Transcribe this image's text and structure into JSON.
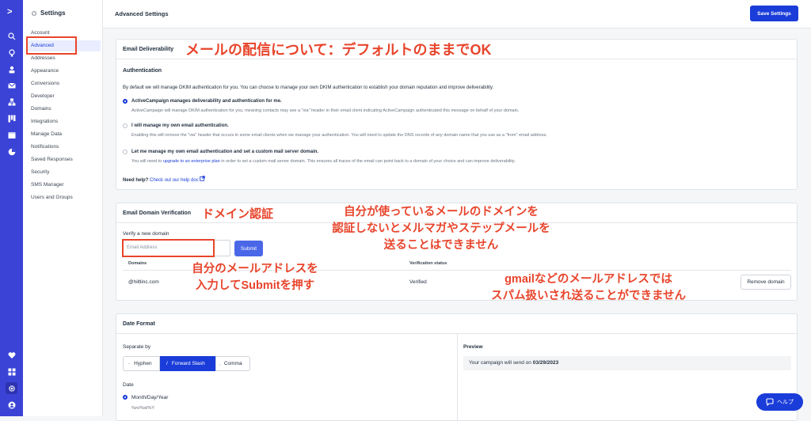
{
  "colors": {
    "brand": "#3b43d6",
    "primary": "#1a3cd9",
    "annotation": "#e8452c"
  },
  "rail": {
    "logo": ">",
    "icons": [
      "search-icon",
      "lightbulb-icon",
      "contacts-icon",
      "email-icon",
      "automations-icon",
      "pipeline-icon",
      "site-icon",
      "reports-icon",
      "heart-icon",
      "apps-icon",
      "gear-icon",
      "avatar-icon"
    ]
  },
  "sidebar": {
    "title": "Settings",
    "items": [
      "Account",
      "Advanced",
      "Addresses",
      "Appearance",
      "Conversions",
      "Developer",
      "Domains",
      "Integrations",
      "Manage Data",
      "Notifications",
      "Saved Responses",
      "Security",
      "SMS Manager",
      "Users and Groups"
    ]
  },
  "header": {
    "title": "Advanced Settings",
    "save_label": "Save Settings"
  },
  "deliverability": {
    "title": "Email Deliverability",
    "section": "Authentication",
    "intro": "By default we will manage DKIM authentication for you. You can choose to manage your own DKIM authentication to establish your domain reputation and improve deliverability.",
    "opt1_title": "ActiveCampaign manages deliverability and authentication for me.",
    "opt1_desc": "ActiveCampaign will manage DKIM authentication for you, meaning contacts may see a \"via\" header in their email client indicating ActiveCampaign authenticated this message on behalf of your domain.",
    "opt2_title": "I will manage my own email authentication.",
    "opt2_desc": "Enabling this will remove the \"via\" header that occurs in some email clients when we manage your authentication. You will need to update the DNS records of any domain name that you use as a \"from\" email address.",
    "opt3_title": "Let me manage my own email authentication and set a custom mail server domain.",
    "opt3_pre": "You will need to",
    "opt3_link": "upgrade to an enterprise plan",
    "opt3_post": "in order to set a custom mail server domain. This ensures all traces of the email can point back to a domain of your choice and can improve deliverability.",
    "help_pre": "Need help?",
    "help_link": "Check out our help doc"
  },
  "verification": {
    "title": "Email Domain Verification",
    "label": "Verify a new domain",
    "placeholder": "Email Address",
    "submit": "Submit",
    "col_domains": "Domains",
    "col_status": "Verification status",
    "domain": "@hiltlinc.com",
    "status": "Verified",
    "remove": "Remove domain"
  },
  "date_format": {
    "title": "Date Format",
    "separate_by": "Separate by",
    "hyphen_sym": "-",
    "hyphen": "Hyphen",
    "slash_sym": "/",
    "slash": "Forward Slash",
    "comma_sym": ",",
    "comma": "Comma",
    "date_label": "Date",
    "date_option": "Month/Day/Year",
    "date_pattern": "%m/%d/%Y",
    "preview_label": "Preview",
    "preview_text": "Your campaign will send on",
    "preview_date": "03/29/2023"
  },
  "annotations": {
    "a1": "メールの配信について：デフォルトのままでOK",
    "a2": "ドメイン認証",
    "a3_l1": "自分が使っているメールのドメインを",
    "a3_l2": "認証しないとメルマガやステップメールを",
    "a3_l3": "送ることはできません",
    "a4_l1": "自分のメールアドレスを",
    "a4_l2": "入力してSubmitを押す",
    "a5_l1": "gmailなどのメールアドレスでは",
    "a5_l2": "スパム扱いされ送ることができません"
  },
  "help_button": "ヘルプ"
}
